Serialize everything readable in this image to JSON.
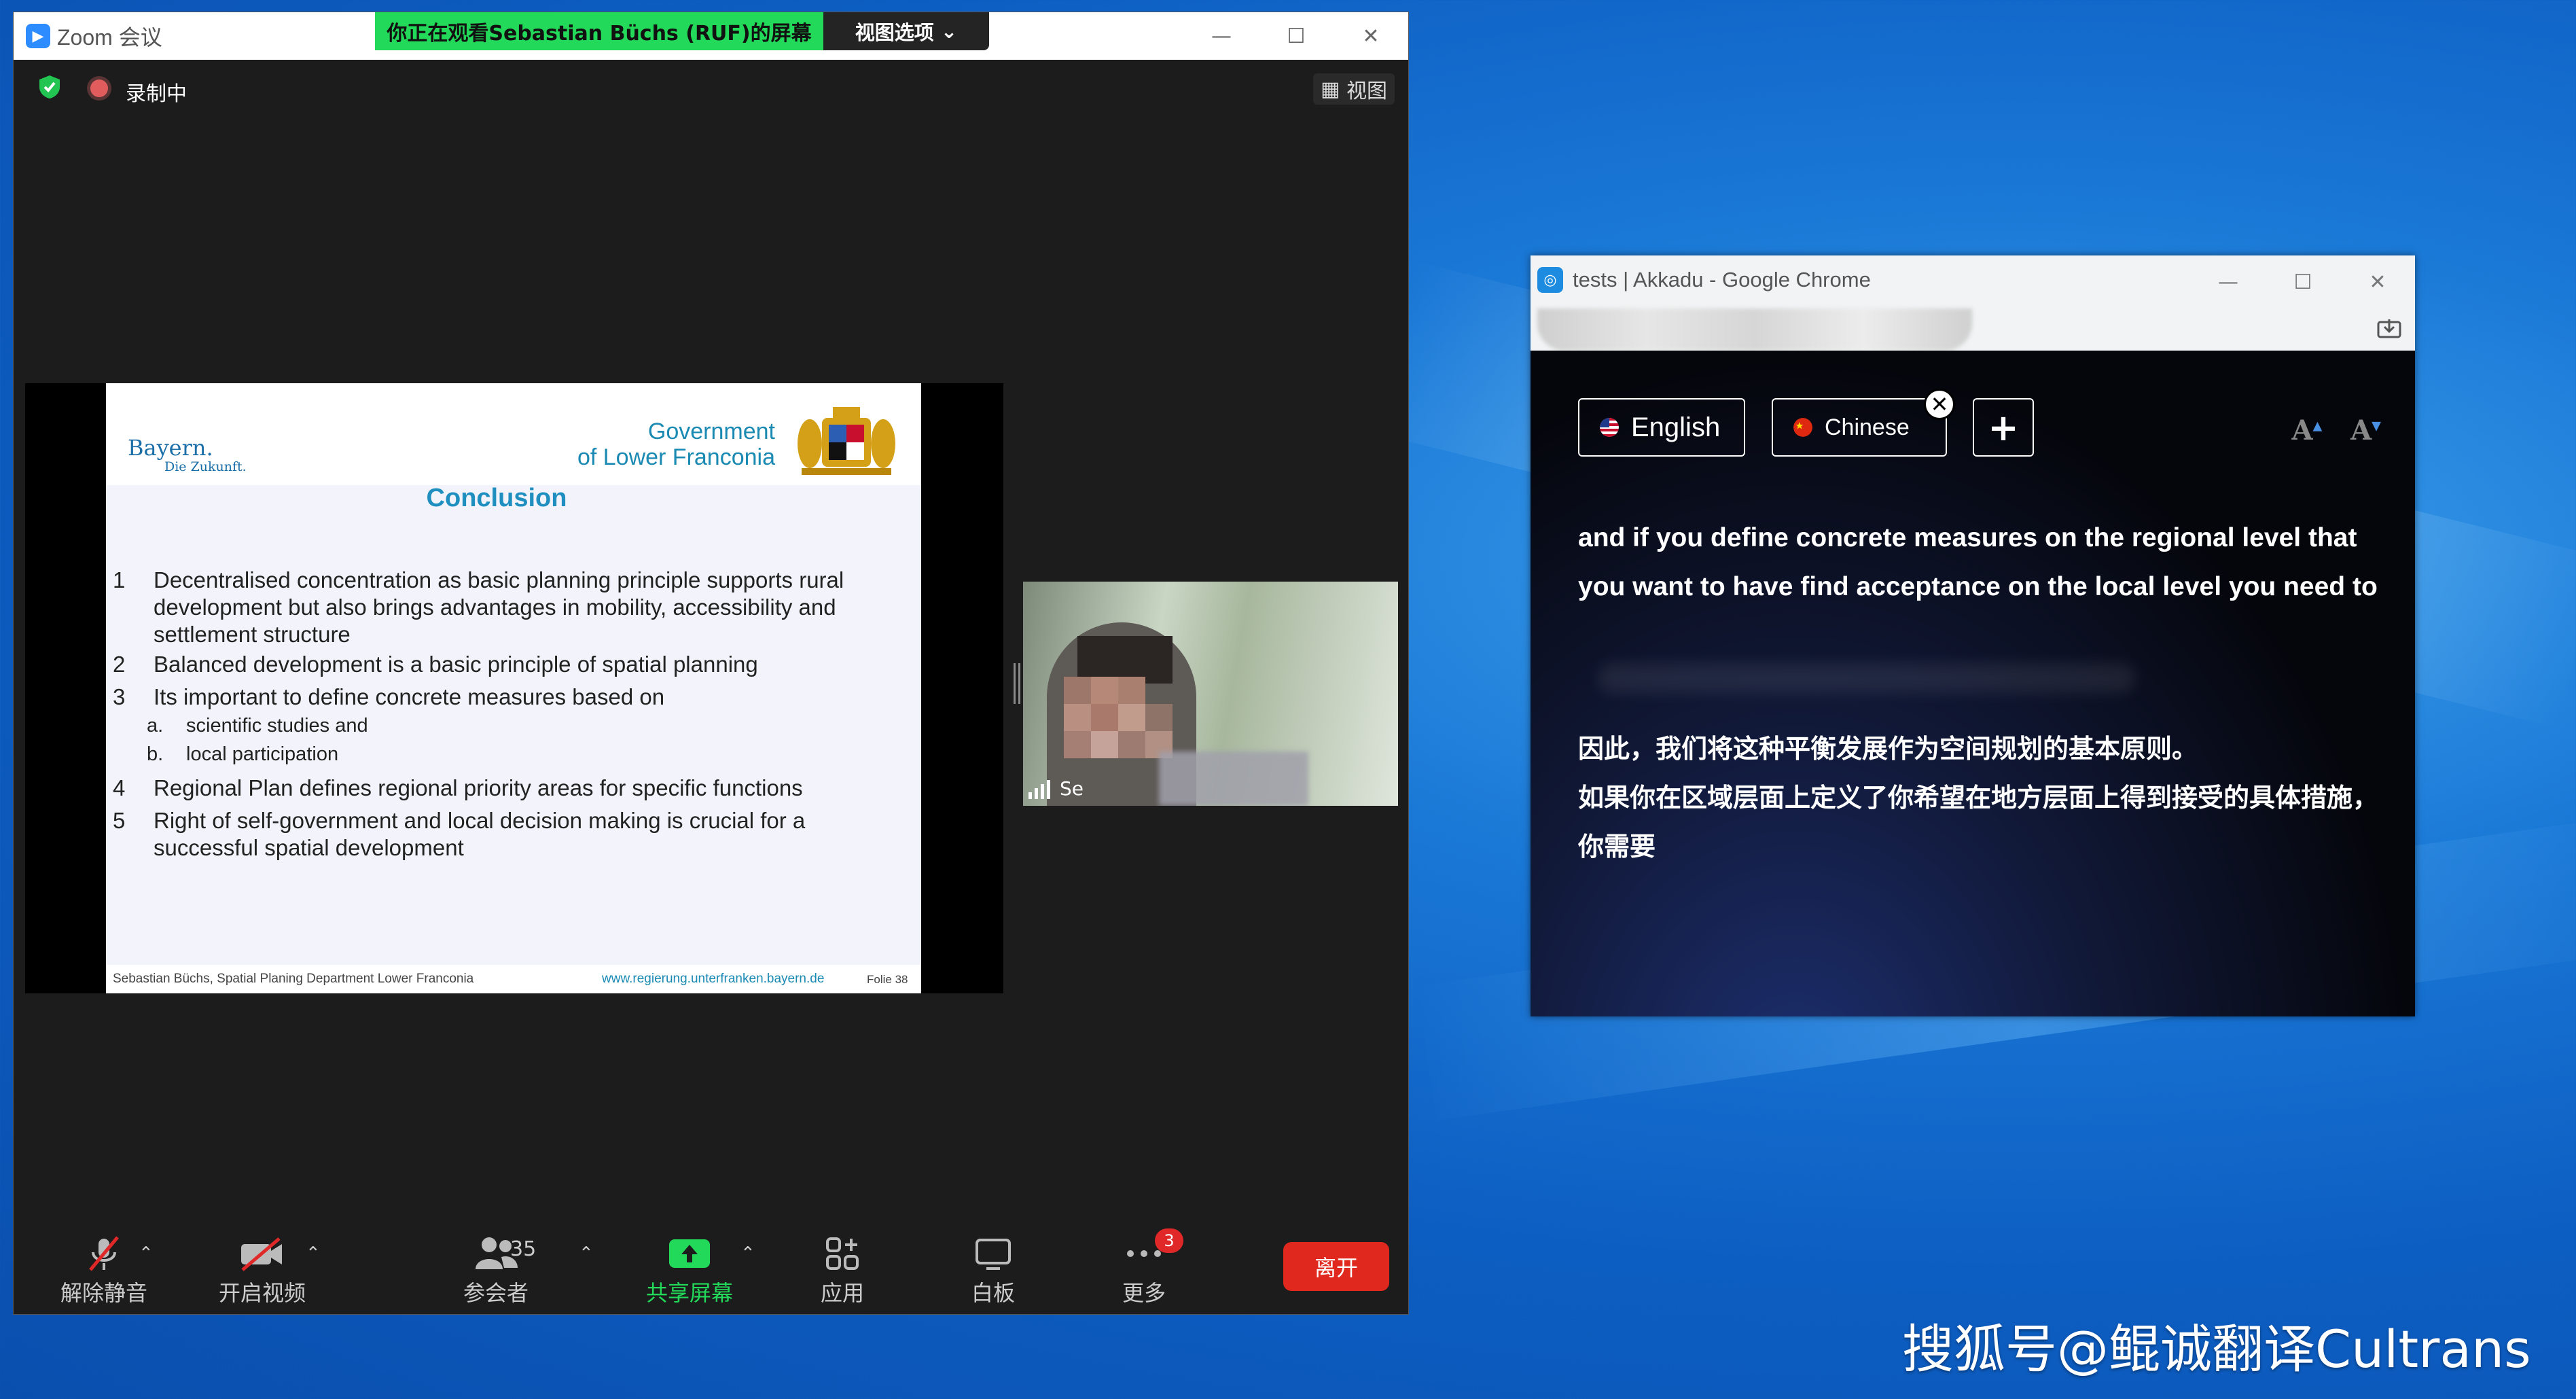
{
  "zoom": {
    "window_title": "Zoom 会议",
    "viewing_banner": "你正在观看Sebastian Büchs (RUF)的屏幕",
    "view_options": "视图选项",
    "recording_label": "录制中",
    "view_button": "视图",
    "controls": {
      "minimize": "—",
      "maximize": "☐",
      "close": "✕"
    },
    "slide": {
      "brand": "Bayern.",
      "brand_sub": "Die Zukunft.",
      "gov_line1": "Government",
      "gov_line2": "of Lower Franconia",
      "title": "Conclusion",
      "items": [
        {
          "num": "1",
          "text": "Decentralised concentration as basic planning principle supports rural development but also brings advantages in mobility, accessibility and settlement structure"
        },
        {
          "num": "2",
          "text": "Balanced development is a basic principle of spatial planning"
        },
        {
          "num": "3",
          "text": "Its important to define concrete measures based on"
        },
        {
          "num": "4",
          "text": "Regional Plan defines regional priority areas for specific functions"
        },
        {
          "num": "5",
          "text": "Right of self-government and local decision making is crucial for a successful spatial development"
        }
      ],
      "subitems": [
        {
          "label": "a.",
          "text": "scientific studies and"
        },
        {
          "label": "b.",
          "text": "local participation"
        }
      ],
      "footer_author": "Sebastian Büchs, Spatial Planing Department Lower Franconia",
      "footer_url": "www.regierung.unterfranken.bayern.de",
      "footer_page": "Folie 38"
    },
    "participant_name": "Se",
    "toolbar": {
      "unmute": "解除静音",
      "start_video": "开启视频",
      "participants": "参会者",
      "participant_count": "35",
      "share_screen": "共享屏幕",
      "apps": "应用",
      "whiteboard": "白板",
      "more": "更多",
      "more_badge": "3",
      "leave": "离开"
    },
    "colors": {
      "share_green": "#23d959",
      "leave_red": "#e0281e"
    }
  },
  "chrome": {
    "window_title": "tests | Akkadu - Google Chrome",
    "controls": {
      "minimize": "—",
      "maximize": "☐",
      "close": "✕"
    },
    "akkadu": {
      "lang_source": "English",
      "lang_target": "Chinese",
      "add_label": "+",
      "close_label": "✕",
      "font_small": "A",
      "font_large": "A",
      "transcript_en": "and if you define concrete measures on the regional level that you want to have find acceptance on the local level you need to",
      "transcript_zh_line1": "因此，我们将这种平衡发展作为空间规划的基本原则。",
      "transcript_zh_line2": "如果你在区域层面上定义了你希望在地方层面上得到接受的具体措施，你需要"
    }
  },
  "watermark": "搜狐号@鲲诚翻译Cultrans"
}
